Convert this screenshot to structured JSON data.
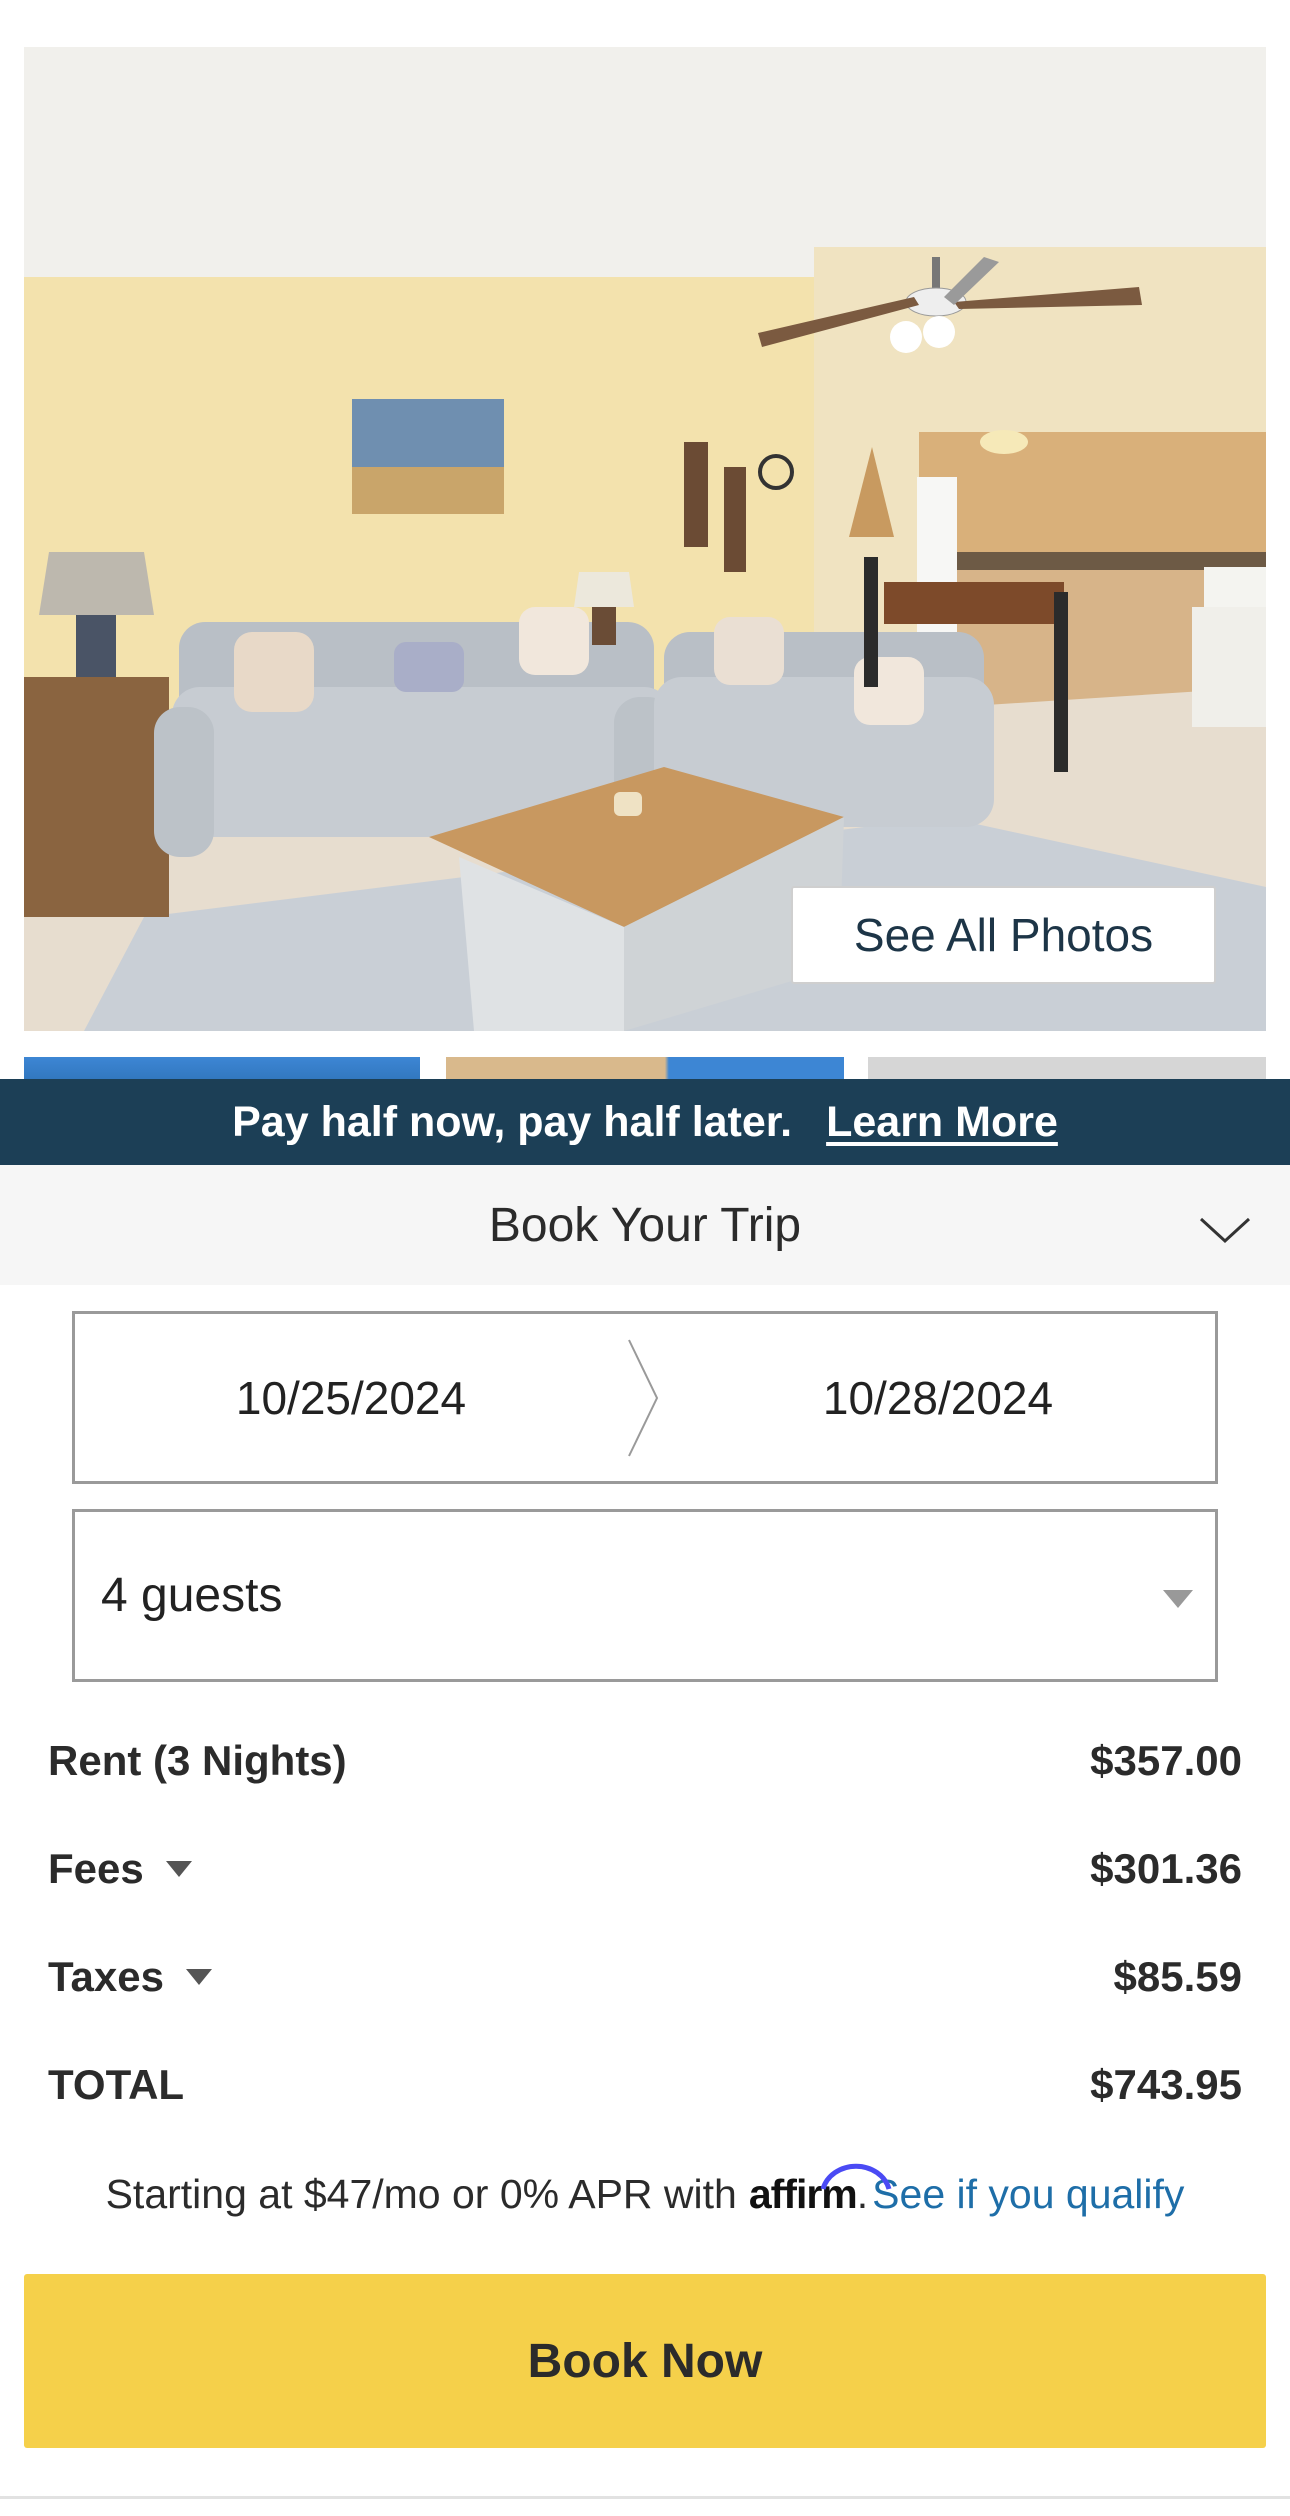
{
  "hero": {
    "see_all_label": "See All Photos"
  },
  "promo": {
    "text": "Pay half now, pay half later.",
    "link": "Learn More"
  },
  "book": {
    "header": "Book Your Trip",
    "checkin": "10/25/2024",
    "checkout": "10/28/2024",
    "guests": "4 guests"
  },
  "pricing": {
    "rows": [
      {
        "label": "Rent (3 Nights)",
        "amount": "$357.00"
      },
      {
        "label": "Fees",
        "amount": "$301.36"
      },
      {
        "label": "Taxes",
        "amount": "$85.59"
      },
      {
        "label": "TOTAL",
        "amount": "$743.95"
      }
    ]
  },
  "affirm": {
    "prefix": "Starting at $47/mo or 0% APR with",
    "logo": "affirm",
    "dot": ".",
    "link": "See if you qualify"
  },
  "cta": {
    "book_now": "Book Now"
  },
  "colors": {
    "banner": "#1c3f56",
    "button": "#f5d04a",
    "link": "#1e6ea8",
    "affirm_arc": "#4a4af4"
  },
  "icons": {
    "book_chevron": "chevron-down-icon",
    "date_separator": "chevron-right-icon",
    "guests_caret": "caret-down-icon",
    "fees_caret": "caret-down-icon",
    "taxes_caret": "caret-down-icon"
  }
}
